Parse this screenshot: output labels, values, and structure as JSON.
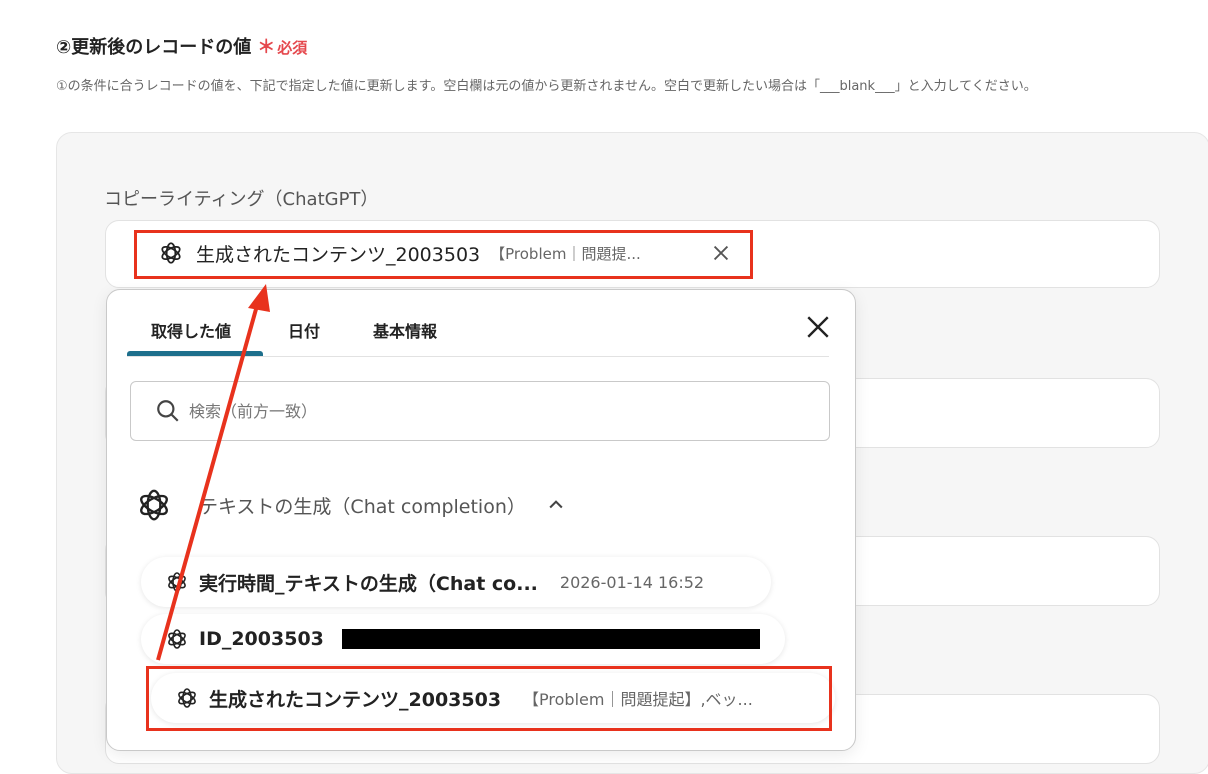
{
  "section": {
    "title": "②更新後のレコードの値",
    "required_mark": "＊",
    "required_text": "必須",
    "description": "①の条件に合うレコードの値を、下記で指定した値に更新します。空白欄は元の値から更新されません。空白で更新したい場合は「___blank___」と入力してください。"
  },
  "field": {
    "label": "コピーライティング（ChatGPT）",
    "chip_label": "生成されたコンテンツ_2003503",
    "chip_preview": "【Problem｜問題提..."
  },
  "dropdown": {
    "tabs": [
      {
        "label": "取得した値",
        "active": true
      },
      {
        "label": "日付",
        "active": false
      },
      {
        "label": "基本情報",
        "active": false
      }
    ],
    "search_placeholder": "検索（前方一致）",
    "group_title": "テキストの生成（Chat completion）",
    "items": [
      {
        "label": "実行時間_テキストの生成（Chat co...",
        "value": "2026-01-14 16:52"
      },
      {
        "label": "ID_2003503",
        "value": ""
      },
      {
        "label": "生成されたコンテンツ_2003503",
        "value": "【Problem｜問題提起】,ベッ..."
      }
    ]
  },
  "colors": {
    "required": "#e5484d",
    "active_tab": "#1d6f8c",
    "annotation": "#e8321d"
  },
  "icons": [
    "openai-icon",
    "close-icon",
    "search-icon",
    "chevron-up-icon"
  ]
}
